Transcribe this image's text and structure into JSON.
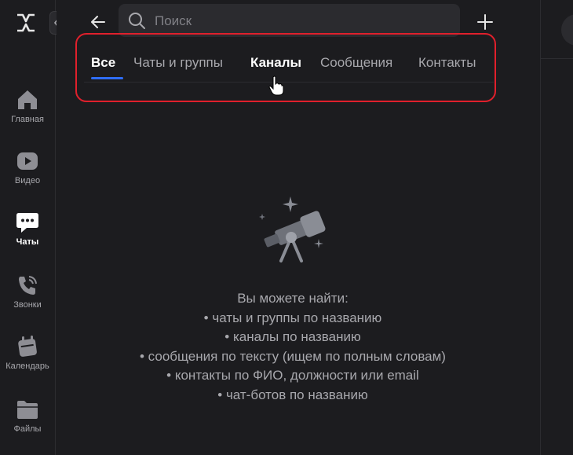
{
  "sidebar": {
    "items": [
      {
        "label": "Главная",
        "icon": "home-icon"
      },
      {
        "label": "Видео",
        "icon": "video-icon"
      },
      {
        "label": "Чаты",
        "icon": "chat-icon"
      },
      {
        "label": "Звонки",
        "icon": "phone-icon"
      },
      {
        "label": "Календарь",
        "icon": "calendar-icon"
      },
      {
        "label": "Файлы",
        "icon": "folder-icon"
      }
    ]
  },
  "search": {
    "placeholder": "Поиск"
  },
  "tabs": [
    {
      "label": "Все"
    },
    {
      "label": "Чаты и группы"
    },
    {
      "label": "Каналы"
    },
    {
      "label": "Сообщения"
    },
    {
      "label": "Контакты"
    }
  ],
  "empty_state": {
    "title": "Вы можете найти:",
    "items": [
      "• чаты и группы по названию",
      "• каналы по названию",
      "• сообщения по тексту (ищем по полным словам)",
      "• контакты по ФИО, должности или email",
      "• чат-ботов по названию"
    ]
  },
  "colors": {
    "accent": "#2f6df6",
    "highlight": "#e0202c",
    "background": "#1c1c1f"
  }
}
